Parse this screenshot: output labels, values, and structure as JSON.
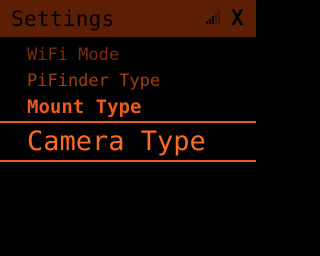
{
  "title_bar": {
    "title": "Settings",
    "status_icon": "signal-icon",
    "status_mark": "X"
  },
  "menu": {
    "items": [
      {
        "label": "WiFi Mode"
      },
      {
        "label": "PiFinder Type"
      },
      {
        "label": "Mount Type"
      },
      {
        "label": "Camera Type",
        "selected": true
      }
    ]
  },
  "colors": {
    "background": "#000000",
    "title_bar": "#5c1f06",
    "item_dim": "#7a2c0c",
    "item_mid": "#a63c12",
    "item_bright": "#e85a1e",
    "item_selected": "#ff6a26"
  }
}
